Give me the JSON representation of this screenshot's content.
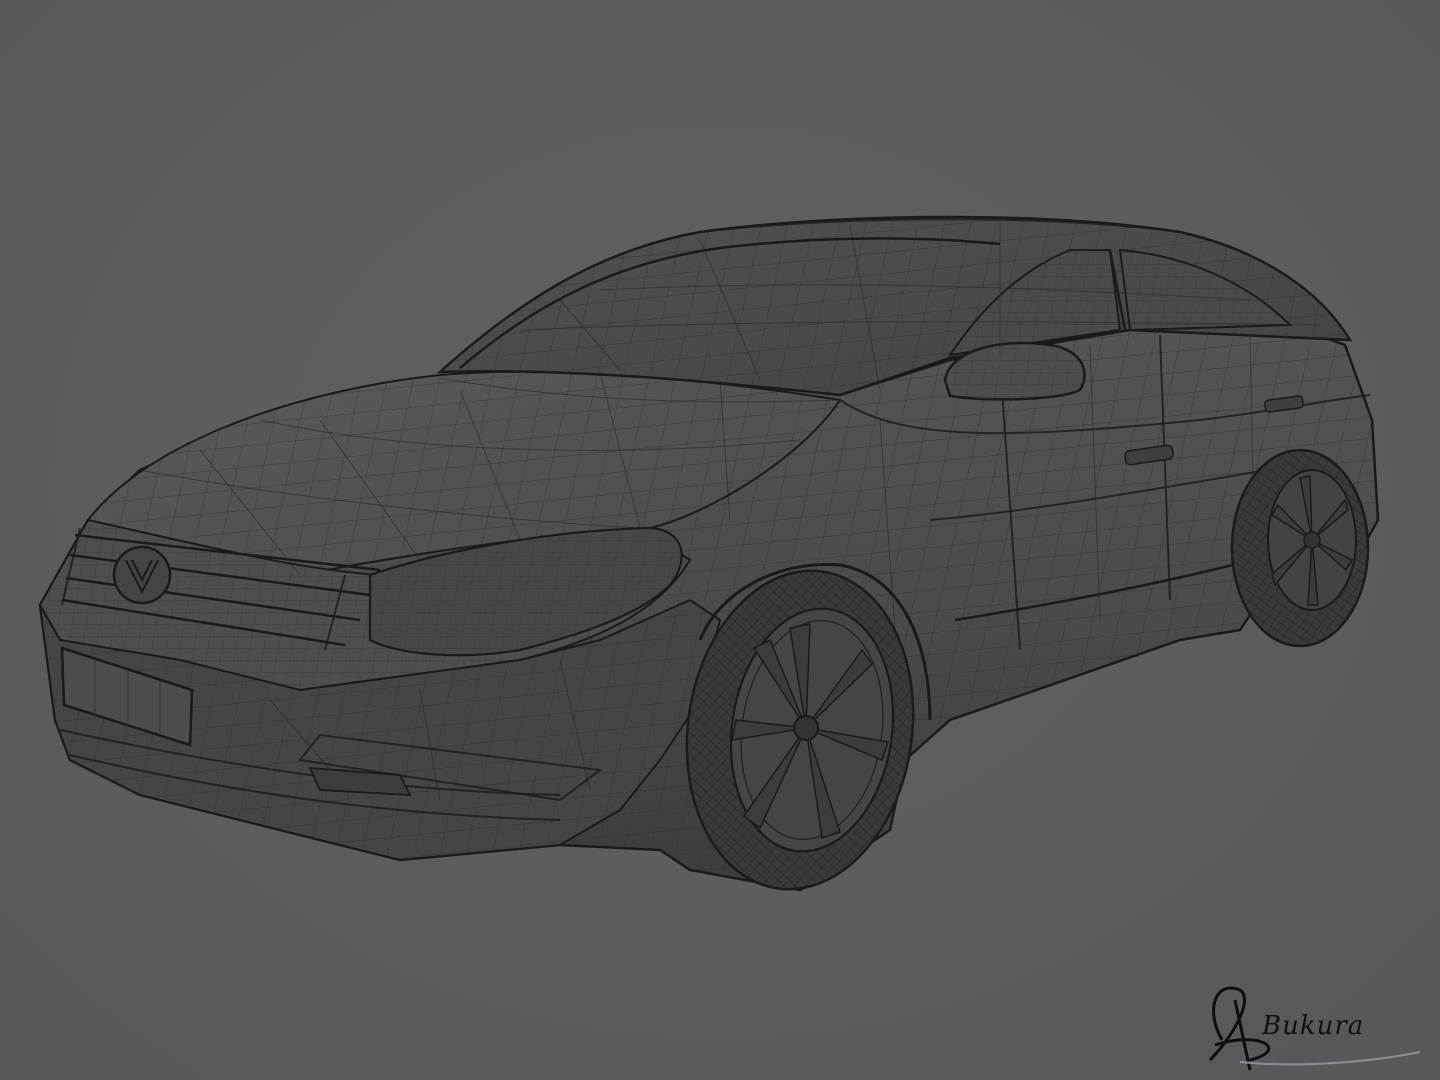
{
  "scene": {
    "subject": "car-wireframe-render",
    "background_color": "#5e5e5e",
    "body_color": "#4a4a4a",
    "wire_color": "#232323",
    "signature_text": "Bukura"
  }
}
